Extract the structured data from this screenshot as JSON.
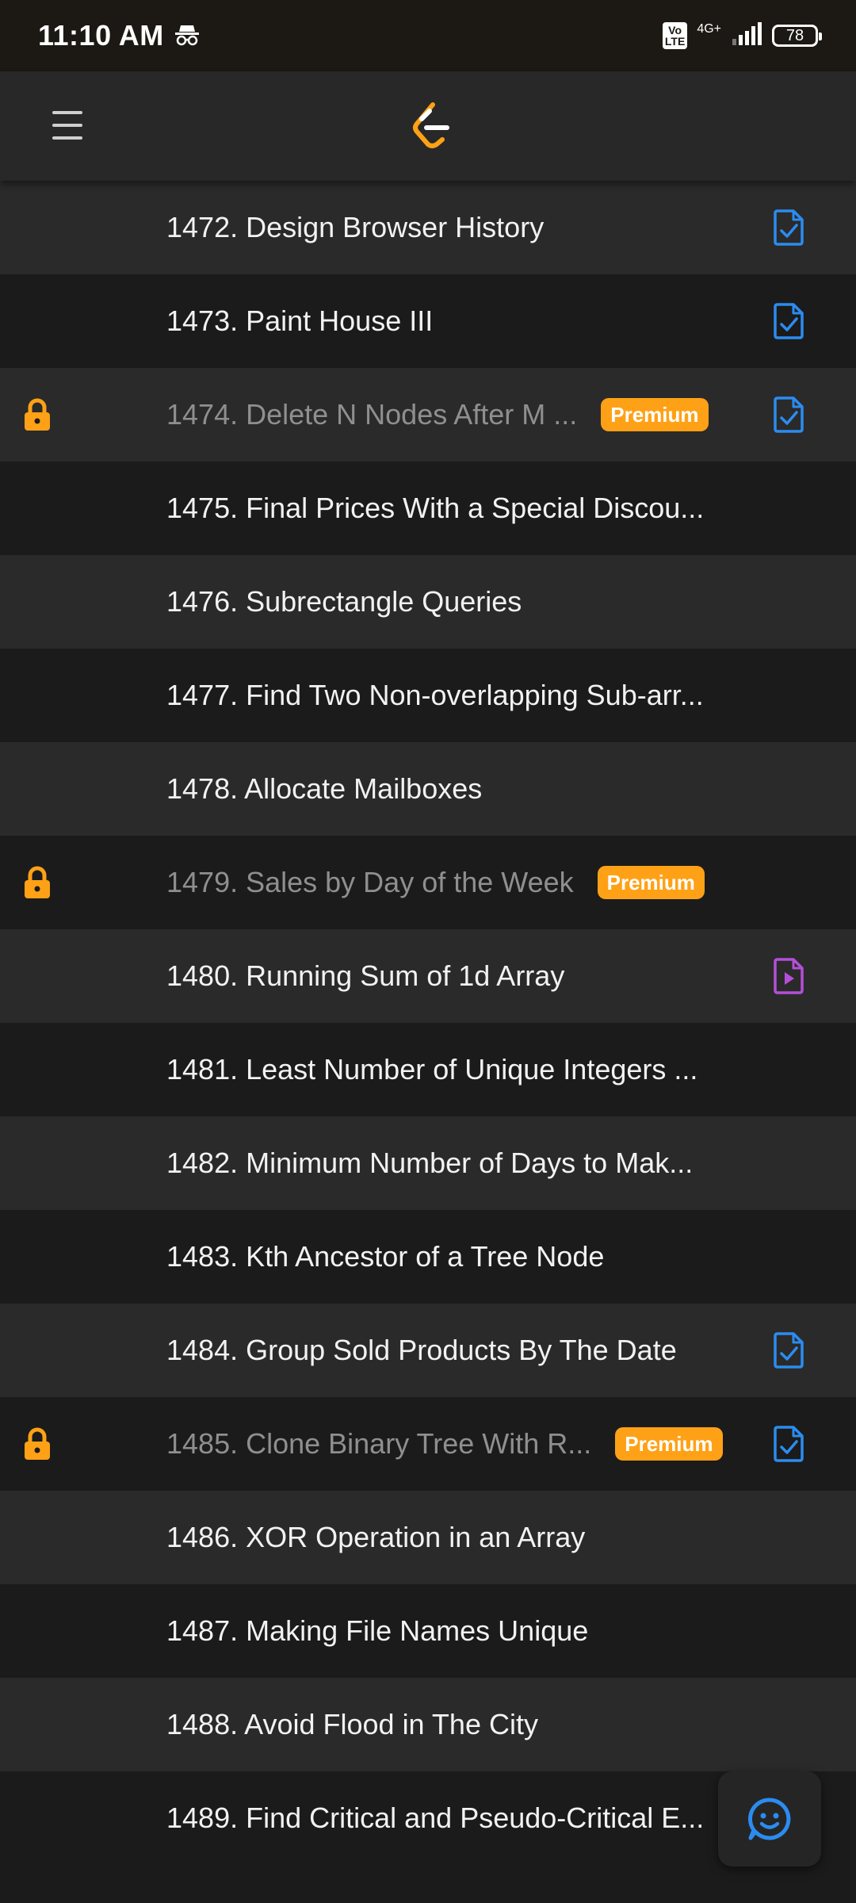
{
  "status_bar": {
    "time": "11:10 AM",
    "volte_top": "Vo",
    "volte_bottom": "LTE",
    "network": "4G+",
    "battery": "78"
  },
  "app_bar": {
    "menu_icon": "hamburger-icon",
    "logo_icon": "leetcode-logo"
  },
  "colors": {
    "premium": "#ffa116",
    "solution": "#2b8cf0",
    "video": "#b44fd8"
  },
  "badge_label": "Premium",
  "problems": [
    {
      "title": "1472. Design Browser History",
      "locked": false,
      "premium": false,
      "status": "solution"
    },
    {
      "title": "1473. Paint House III",
      "locked": false,
      "premium": false,
      "status": "solution"
    },
    {
      "title": "1474. Delete N Nodes After M ...",
      "locked": true,
      "premium": true,
      "status": "solution"
    },
    {
      "title": "1475. Final Prices With a Special Discou...",
      "locked": false,
      "premium": false,
      "status": ""
    },
    {
      "title": "1476. Subrectangle Queries",
      "locked": false,
      "premium": false,
      "status": ""
    },
    {
      "title": "1477. Find Two Non-overlapping Sub-arr...",
      "locked": false,
      "premium": false,
      "status": ""
    },
    {
      "title": "1478. Allocate Mailboxes",
      "locked": false,
      "premium": false,
      "status": ""
    },
    {
      "title": "1479. Sales by Day of the Week",
      "locked": true,
      "premium": true,
      "status": ""
    },
    {
      "title": "1480. Running Sum of 1d Array",
      "locked": false,
      "premium": false,
      "status": "video"
    },
    {
      "title": "1481. Least Number of Unique Integers ...",
      "locked": false,
      "premium": false,
      "status": ""
    },
    {
      "title": "1482. Minimum Number of Days to Mak...",
      "locked": false,
      "premium": false,
      "status": ""
    },
    {
      "title": "1483. Kth Ancestor of a Tree Node",
      "locked": false,
      "premium": false,
      "status": ""
    },
    {
      "title": "1484. Group Sold Products By The Date",
      "locked": false,
      "premium": false,
      "status": "solution"
    },
    {
      "title": "1485. Clone Binary Tree With R...",
      "locked": true,
      "premium": true,
      "status": "solution"
    },
    {
      "title": "1486. XOR Operation in an Array",
      "locked": false,
      "premium": false,
      "status": ""
    },
    {
      "title": "1487. Making File Names Unique",
      "locked": false,
      "premium": false,
      "status": ""
    },
    {
      "title": "1488. Avoid Flood in The City",
      "locked": false,
      "premium": false,
      "status": ""
    },
    {
      "title": "1489. Find Critical and Pseudo-Critical E...",
      "locked": false,
      "premium": false,
      "status": ""
    }
  ],
  "fab_icon": "chat-feedback-icon"
}
